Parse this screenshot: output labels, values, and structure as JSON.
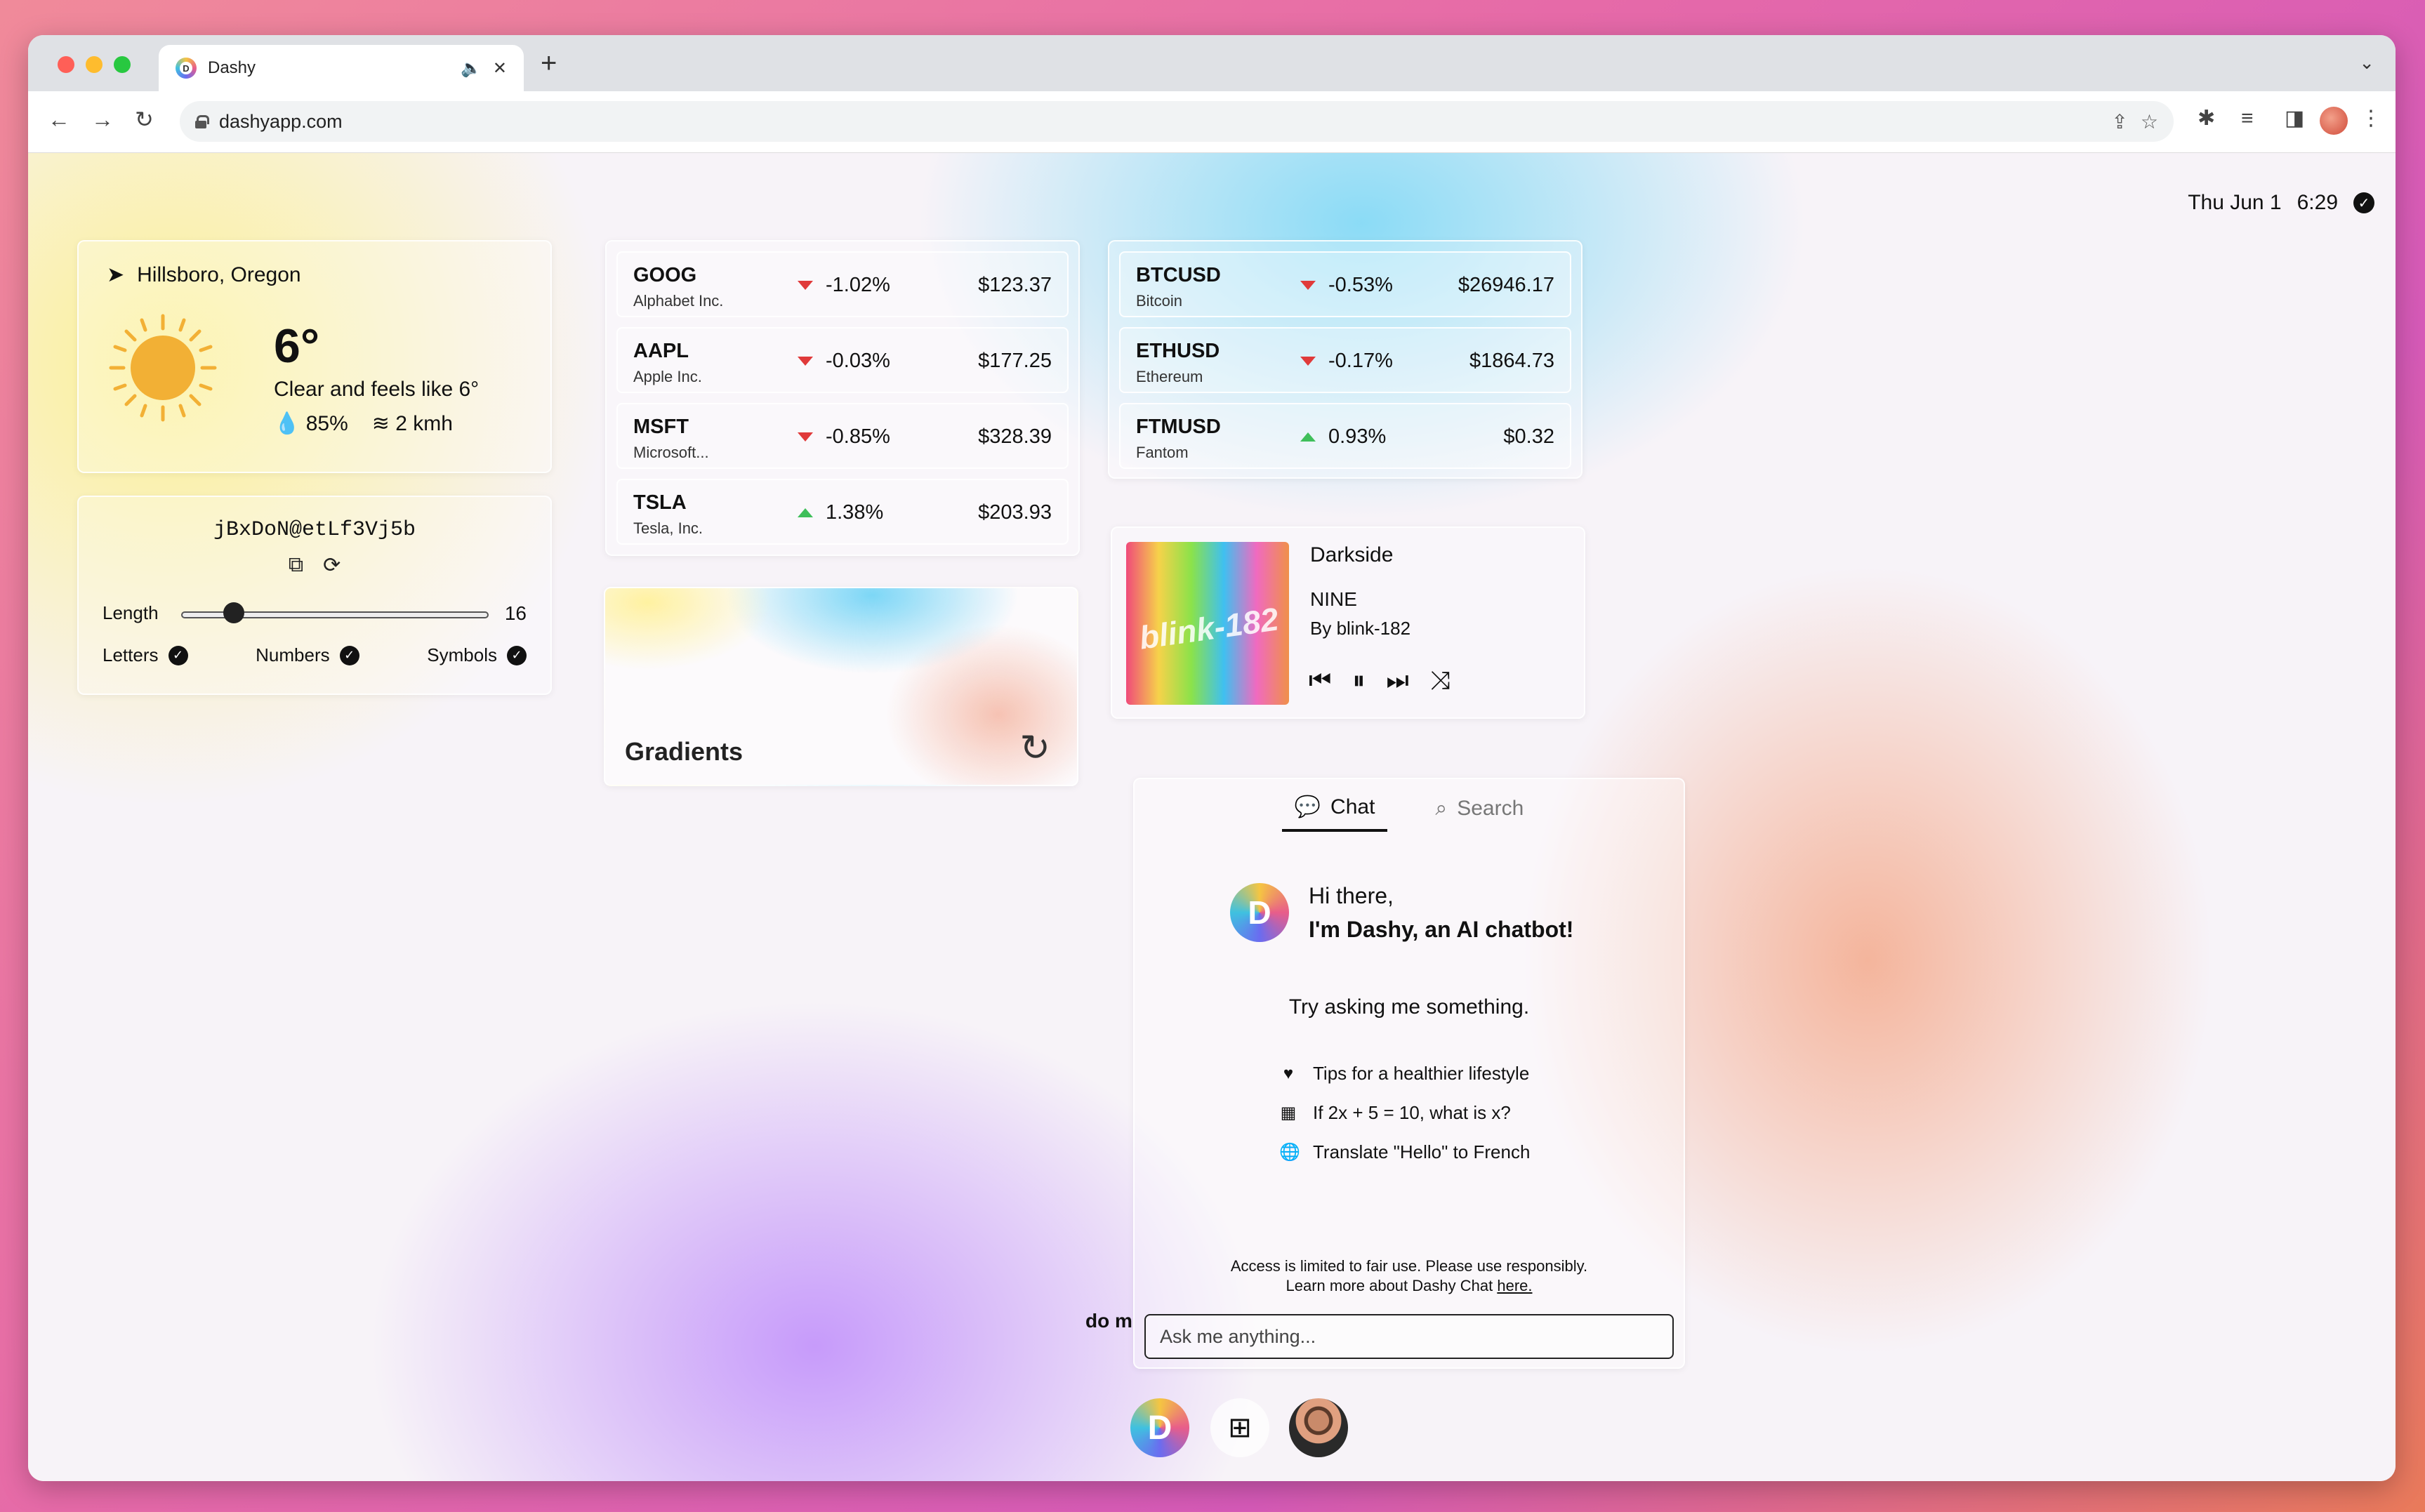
{
  "browser": {
    "tab": {
      "title": "Dashy",
      "favicon_letter": "D"
    },
    "url": "dashyapp.com",
    "icons": [
      "back-icon",
      "forward-icon",
      "reload-icon",
      "lock-icon",
      "share-icon",
      "star-icon",
      "extensions-icon",
      "media-icon",
      "sidepanel-icon",
      "menu-icon"
    ],
    "traffic_lights": [
      "#ff5f57",
      "#febc2e",
      "#28c840"
    ]
  },
  "clock": {
    "date": "Thu Jun 1",
    "time": "6:29"
  },
  "weather": {
    "location": "Hillsboro, Oregon",
    "temperature": "6°",
    "description": "Clear and feels like 6°",
    "humidity": "85%",
    "wind": "2 kmh"
  },
  "password": {
    "value": "jBxDoN@etLf3Vj5b",
    "length_label": "Length",
    "length": "16",
    "options": {
      "letters": "Letters",
      "numbers": "Numbers",
      "symbols": "Symbols"
    }
  },
  "stocks": [
    {
      "symbol": "GOOG",
      "name": "Alphabet Inc.",
      "change": "-1.02%",
      "price": "$123.37",
      "direction": "down"
    },
    {
      "symbol": "AAPL",
      "name": "Apple Inc.",
      "change": "-0.03%",
      "price": "$177.25",
      "direction": "down"
    },
    {
      "symbol": "MSFT",
      "name": "Microsoft...",
      "change": "-0.85%",
      "price": "$328.39",
      "direction": "down"
    },
    {
      "symbol": "TSLA",
      "name": "Tesla, Inc.",
      "change": "1.38%",
      "price": "$203.93",
      "direction": "up"
    }
  ],
  "cryptos": [
    {
      "symbol": "BTCUSD",
      "name": "Bitcoin",
      "change": "-0.53%",
      "price": "$26946.17",
      "direction": "down"
    },
    {
      "symbol": "ETHUSD",
      "name": "Ethereum",
      "change": "-0.17%",
      "price": "$1864.73",
      "direction": "down"
    },
    {
      "symbol": "FTMUSD",
      "name": "Fantom",
      "change": "0.93%",
      "price": "$0.32",
      "direction": "up"
    }
  ],
  "gradients": {
    "title": "Gradients"
  },
  "music": {
    "title": "Darkside",
    "album": "NINE",
    "artist": "By blink-182",
    "album_art_text": "blink-182"
  },
  "chat": {
    "tabs": {
      "chat": "Chat",
      "search": "Search"
    },
    "greeting": "Hi there,",
    "intro": "I'm Dashy, an AI chatbot!",
    "prompt": "Try asking me something.",
    "suggestions": [
      {
        "icon": "heart-icon",
        "text": "Tips for a healthier lifestyle"
      },
      {
        "icon": "grid-icon",
        "text": "If 2x + 5 = 10, what is x?"
      },
      {
        "icon": "globe-icon",
        "text": "Translate \"Hello\" to French"
      }
    ],
    "footer_line1": "Access is limited to fair use. Please use responsibly.",
    "footer_line2": "Learn more about Dashy Chat",
    "footer_link": "here.",
    "input_placeholder": "Ask me anything..."
  },
  "behind_text": "do m",
  "dock": {
    "dashy_letter": "D"
  },
  "colors": {
    "down": "#e03a3a",
    "up": "#3fbf5a",
    "sun": "#f2b035"
  }
}
